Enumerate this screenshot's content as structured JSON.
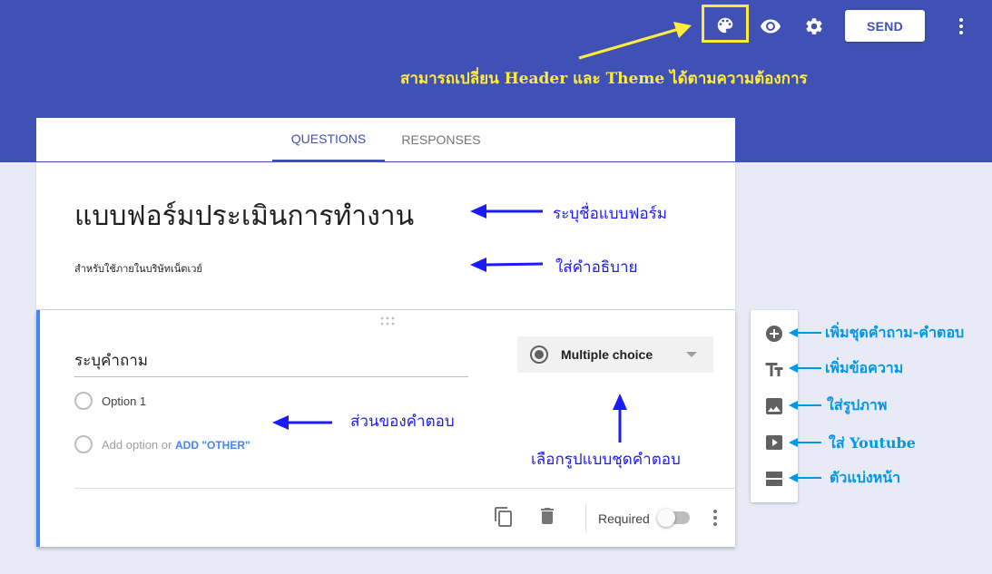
{
  "header": {
    "send_label": "SEND",
    "theme_note": "สามารถเปลี่ยน Header และ Theme ได้ตามความต้องการ",
    "icons": [
      "palette-icon",
      "eye-icon",
      "gear-icon",
      "more-vert-icon"
    ],
    "colors": {
      "band": "#3f51b5",
      "highlight": "#ffeb3b"
    }
  },
  "tabs": [
    {
      "label": "QUESTIONS",
      "active": true
    },
    {
      "label": "RESPONSES",
      "active": false
    }
  ],
  "form": {
    "title": "แบบฟอร์มประเมินการทำงาน",
    "description": "สำหรับใช้ภายในบริษัทเน็ตเวย์"
  },
  "question": {
    "title": "ระบุคำถาม",
    "option1": "Option 1",
    "add_option": "Add option",
    "or": "or",
    "add_other": "ADD \"OTHER\"",
    "type": "Multiple choice",
    "required_label": "Required",
    "required": false
  },
  "sidebar": {
    "icons": [
      "add-circle-icon",
      "text-title-icon",
      "image-icon",
      "video-icon",
      "section-icon"
    ]
  },
  "annotations": {
    "title": "ระบุชื่อแบบฟอร์ม",
    "description": "ใส่คำอธิบาย",
    "answers": "ส่วนของคำตอบ",
    "choose_type": "เลือกรูปแบบชุดคำตอบ",
    "add_question": "เพิ่มชุดคำถาม-คำตอบ",
    "add_text": "เพิ่มข้อความ",
    "add_image": "ใส่รูปภาพ",
    "add_youtube": "ใส่ Youtube",
    "add_section": "ตัวแบ่งหน้า"
  }
}
